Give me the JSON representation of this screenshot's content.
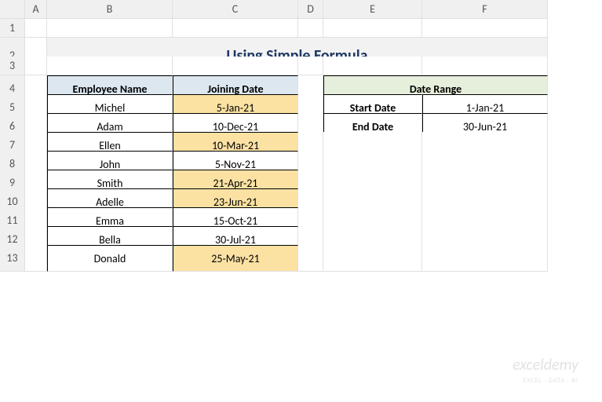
{
  "columns": [
    "",
    "A",
    "B",
    "C",
    "D",
    "E",
    "F"
  ],
  "rows": [
    "1",
    "2",
    "3",
    "4",
    "5",
    "6",
    "7",
    "8",
    "9",
    "10",
    "11",
    "12",
    "13"
  ],
  "title": "Using Simple Formula",
  "employeeTable": {
    "headers": {
      "name": "Employee Name",
      "date": "Joining Date"
    },
    "rows": [
      {
        "name": "Michel",
        "date": "5-Jan-21",
        "highlight": true
      },
      {
        "name": "Adam",
        "date": "10-Dec-21",
        "highlight": false
      },
      {
        "name": "Ellen",
        "date": "10-Mar-21",
        "highlight": true
      },
      {
        "name": "John",
        "date": "5-Nov-21",
        "highlight": false
      },
      {
        "name": "Smith",
        "date": "21-Apr-21",
        "highlight": true
      },
      {
        "name": "Adelle",
        "date": "23-Jun-21",
        "highlight": true
      },
      {
        "name": "Emma",
        "date": "15-Oct-21",
        "highlight": false
      },
      {
        "name": "Bella",
        "date": "30-Jul-21",
        "highlight": false
      },
      {
        "name": "Donald",
        "date": "25-May-21",
        "highlight": true
      }
    ]
  },
  "dateRange": {
    "header": "Date Range",
    "startLabel": "Start Date",
    "startValue": "1-Jan-21",
    "endLabel": "End Date",
    "endValue": "30-Jun-21"
  },
  "watermark": {
    "main": "exceldemy",
    "sub": "EXCEL · DATA · BI"
  }
}
